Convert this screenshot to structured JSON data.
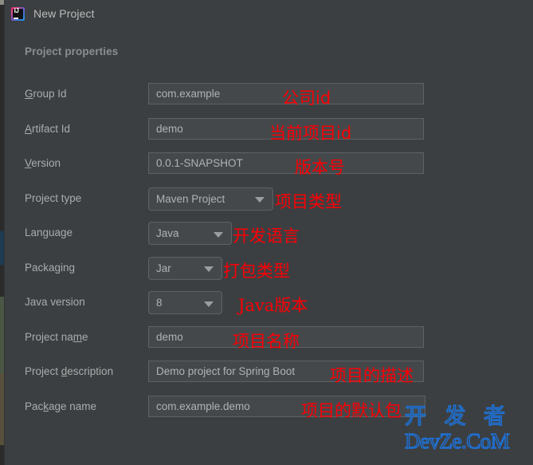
{
  "window": {
    "title": "New Project",
    "app_icon": "intellij-idea-icon",
    "background_color": "#3c3f41"
  },
  "section": {
    "heading": "Project properties"
  },
  "annotation_color": "#fb0006",
  "rows": [
    {
      "label_prefix": "",
      "label_mnemonic": "G",
      "label_suffix": "roup Id",
      "control": "textfield",
      "value": "com.example",
      "annotation": "公司id"
    },
    {
      "label_prefix": "",
      "label_mnemonic": "A",
      "label_suffix": "rtifact Id",
      "control": "textfield",
      "value": "demo",
      "annotation": "当前项目id"
    },
    {
      "label_prefix": "",
      "label_mnemonic": "V",
      "label_suffix": "ersion",
      "control": "textfield",
      "value": "0.0.1-SNAPSHOT",
      "annotation": "版本号"
    },
    {
      "label_prefix": "Project type",
      "label_mnemonic": "",
      "label_suffix": "",
      "control": "combo",
      "value": "Maven Project",
      "annotation": "项目类型"
    },
    {
      "label_prefix": "Language",
      "label_mnemonic": "",
      "label_suffix": "",
      "control": "combo",
      "value": "Java",
      "annotation": "开发语言"
    },
    {
      "label_prefix": "Packaging",
      "label_mnemonic": "",
      "label_suffix": "",
      "control": "combo",
      "value": "Jar",
      "annotation": "打包类型"
    },
    {
      "label_prefix": "Java version",
      "label_mnemonic": "",
      "label_suffix": "",
      "control": "combo",
      "value": "8",
      "annotation": "Java版本"
    },
    {
      "label_prefix": "Project na",
      "label_mnemonic": "m",
      "label_suffix": "e",
      "control": "textfield",
      "value": "demo",
      "annotation": "项目名称"
    },
    {
      "label_prefix": "Project ",
      "label_mnemonic": "d",
      "label_suffix": "escription",
      "control": "textfield",
      "value": "Demo project for Spring Boot",
      "annotation": "项目的描述"
    },
    {
      "label_prefix": "Pac",
      "label_mnemonic": "k",
      "label_suffix": "age name",
      "control": "textfield",
      "value": "com.example.demo",
      "annotation": "项目的默认包"
    }
  ],
  "watermark": {
    "chinese": "开 发 者",
    "latin": "DevZe.CoM",
    "color": "#1f6fd0"
  }
}
